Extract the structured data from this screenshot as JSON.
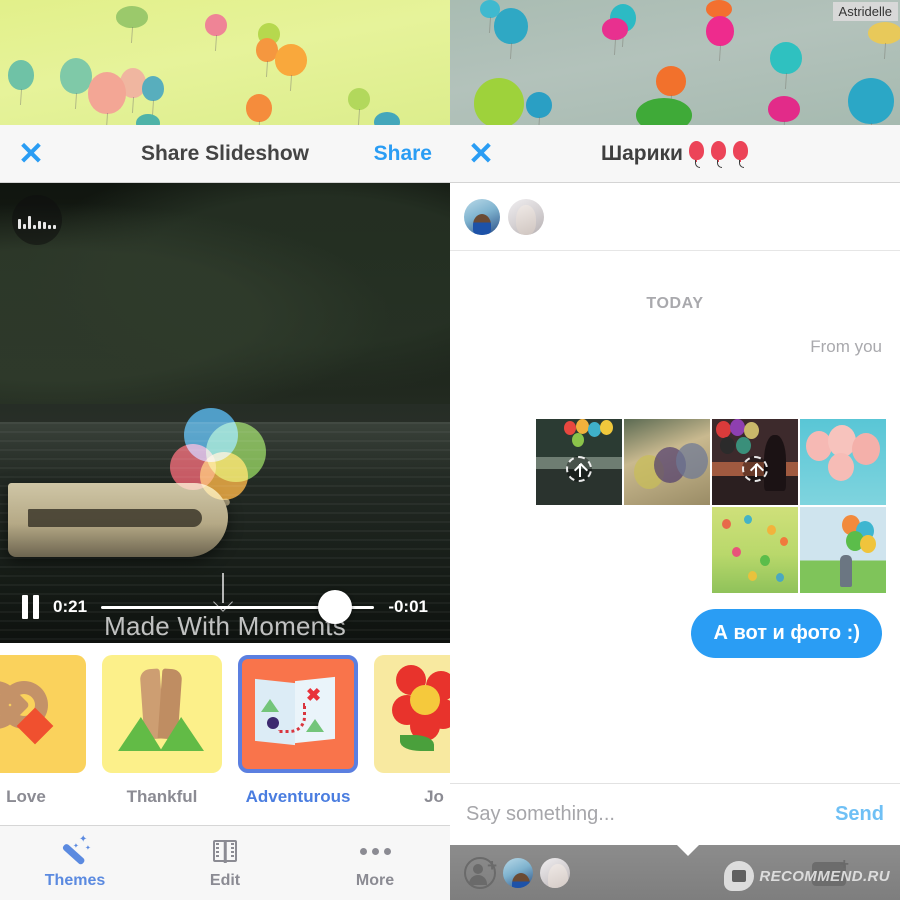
{
  "watermarks": {
    "corner_label": "Astridelle",
    "footer_brand": "RECOMMEND.RU"
  },
  "left_pane": {
    "navbar": {
      "close_icon": "close-icon",
      "title": "Share Slideshow",
      "action_label": "Share"
    },
    "video": {
      "sound_badge_icon": "audio-levels-icon",
      "overlay_text": "Made With Moments",
      "logo_name": "moments-balloons-logo",
      "controls": {
        "pause_icon": "pause-icon",
        "elapsed": "0:21",
        "remaining": "-0:01",
        "progress_percent": 94
      }
    },
    "themes": [
      {
        "label": "Love",
        "art": "heart-hands",
        "tile_color": "#fad25c",
        "selected": false
      },
      {
        "label": "Thankful",
        "art": "praying-hands",
        "tile_color": "#fcf08a",
        "selected": false
      },
      {
        "label": "Adventurous",
        "art": "treasure-map",
        "tile_color": "#f9744b",
        "selected": true
      },
      {
        "label": "Jo",
        "art": "flower",
        "tile_color": "#f8e9a0",
        "selected": false
      }
    ],
    "tabs": [
      {
        "label": "Themes",
        "icon": "magic-wand-icon",
        "active": true
      },
      {
        "label": "Edit",
        "icon": "film-strip-icon",
        "active": false
      },
      {
        "label": "More",
        "icon": "ellipsis-icon",
        "active": false
      }
    ]
  },
  "right_pane": {
    "navbar": {
      "close_icon": "close-icon",
      "title": "Шарики",
      "title_emoji_count": 3,
      "emoji_name": "balloon-emoji"
    },
    "participants": [
      {
        "name": "participant-avatar-1"
      },
      {
        "name": "participant-avatar-2"
      }
    ],
    "chat": {
      "day_separator": "TODAY",
      "sender_label": "From you",
      "photos": [
        {
          "caption": "balloons-over-boat",
          "uploading": true
        },
        {
          "caption": "balloons-held-up",
          "uploading": false
        },
        {
          "caption": "girl-with-balloons-sunset",
          "uploading": true
        },
        {
          "caption": "pink-balloons-sky",
          "uploading": false
        },
        {
          "caption": "confetti-balloons",
          "uploading": false
        },
        {
          "caption": "child-with-balloons",
          "uploading": false
        }
      ],
      "message": "А вот и фото :)"
    },
    "composer": {
      "placeholder": "Say something...",
      "send_label": "Send"
    },
    "footer": {
      "add_person_icon": "add-person-icon",
      "avatars": [
        "footer-avatar-1",
        "footer-avatar-2"
      ]
    }
  },
  "colors": {
    "accent_blue": "#2a9df4",
    "tab_active": "#5b8ae0",
    "selected_border": "#5b7fe0",
    "muted_text": "#8b8b93"
  }
}
